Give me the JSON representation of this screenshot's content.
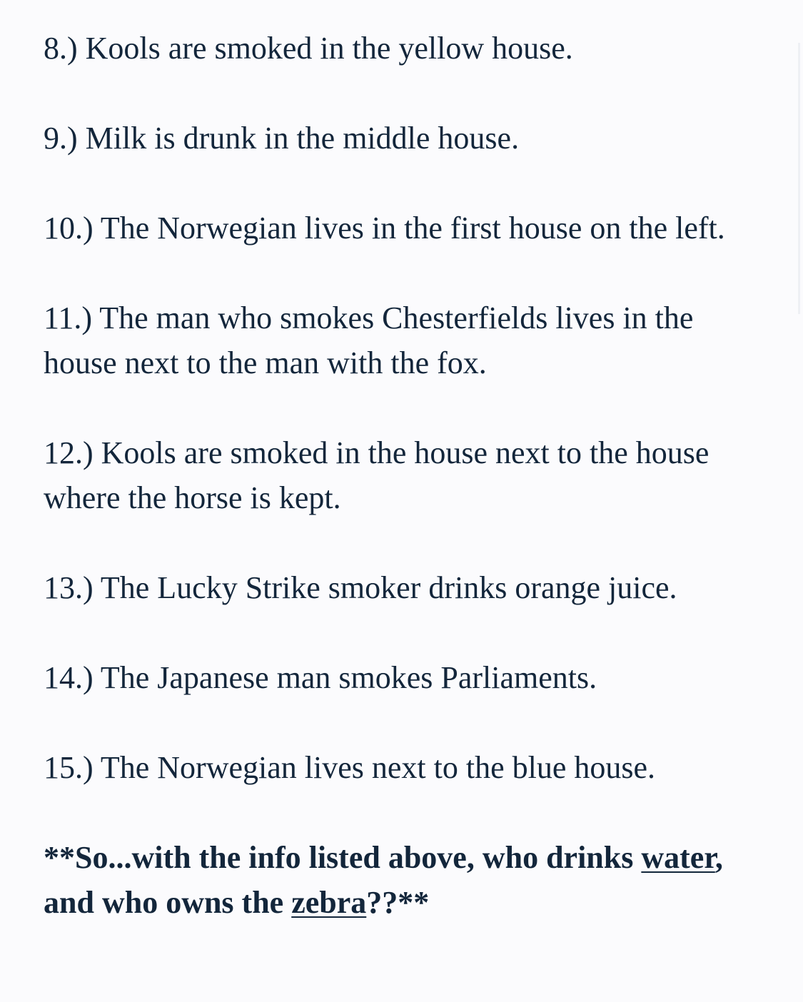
{
  "clues": [
    {
      "number": "8.)",
      "text": "Kools are smoked in the yellow house."
    },
    {
      "number": "9.)",
      "text": "Milk is drunk in the middle house."
    },
    {
      "number": "10.)",
      "text": "The Norwegian lives in the first house on the left."
    },
    {
      "number": "11.)",
      "text": "The man who smokes Chesterfields lives in the house next to the man with the fox."
    },
    {
      "number": "12.)",
      "text": "Kools are smoked in the house next to the house where the horse is kept."
    },
    {
      "number": "13.)",
      "text": "The Lucky Strike smoker drinks orange juice."
    },
    {
      "number": "14.)",
      "text": "The Japanese man smokes Parliaments."
    },
    {
      "number": "15.)",
      "text": "The Norwegian lives next to the blue house."
    }
  ],
  "closing": {
    "part1": "**So...with the info listed above, who drinks ",
    "underline1": "water",
    "part2": ", and who owns the ",
    "underline2": "zebra",
    "part3": "??**"
  }
}
